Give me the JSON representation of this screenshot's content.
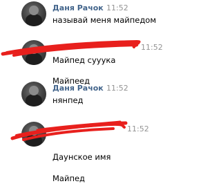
{
  "messages": [
    {
      "author": "Даня Рачок",
      "time": "11:52",
      "lines": [
        "называй меня майпедом"
      ],
      "author_redacted": false
    },
    {
      "author": "",
      "time": "11:52",
      "lines": [
        "Майпед сууука",
        "Майпеед"
      ],
      "author_redacted": true
    },
    {
      "author": "Даня Рачок",
      "time": "11:52",
      "lines": [
        "нянпед"
      ],
      "author_redacted": false
    },
    {
      "author": "",
      "time": "11:52",
      "lines": [
        "Даунское имя",
        "Майпед"
      ],
      "author_redacted": true
    }
  ],
  "colors": {
    "author": "#42648b",
    "time": "#939393",
    "text": "#000000",
    "redaction": "#e8201d"
  }
}
